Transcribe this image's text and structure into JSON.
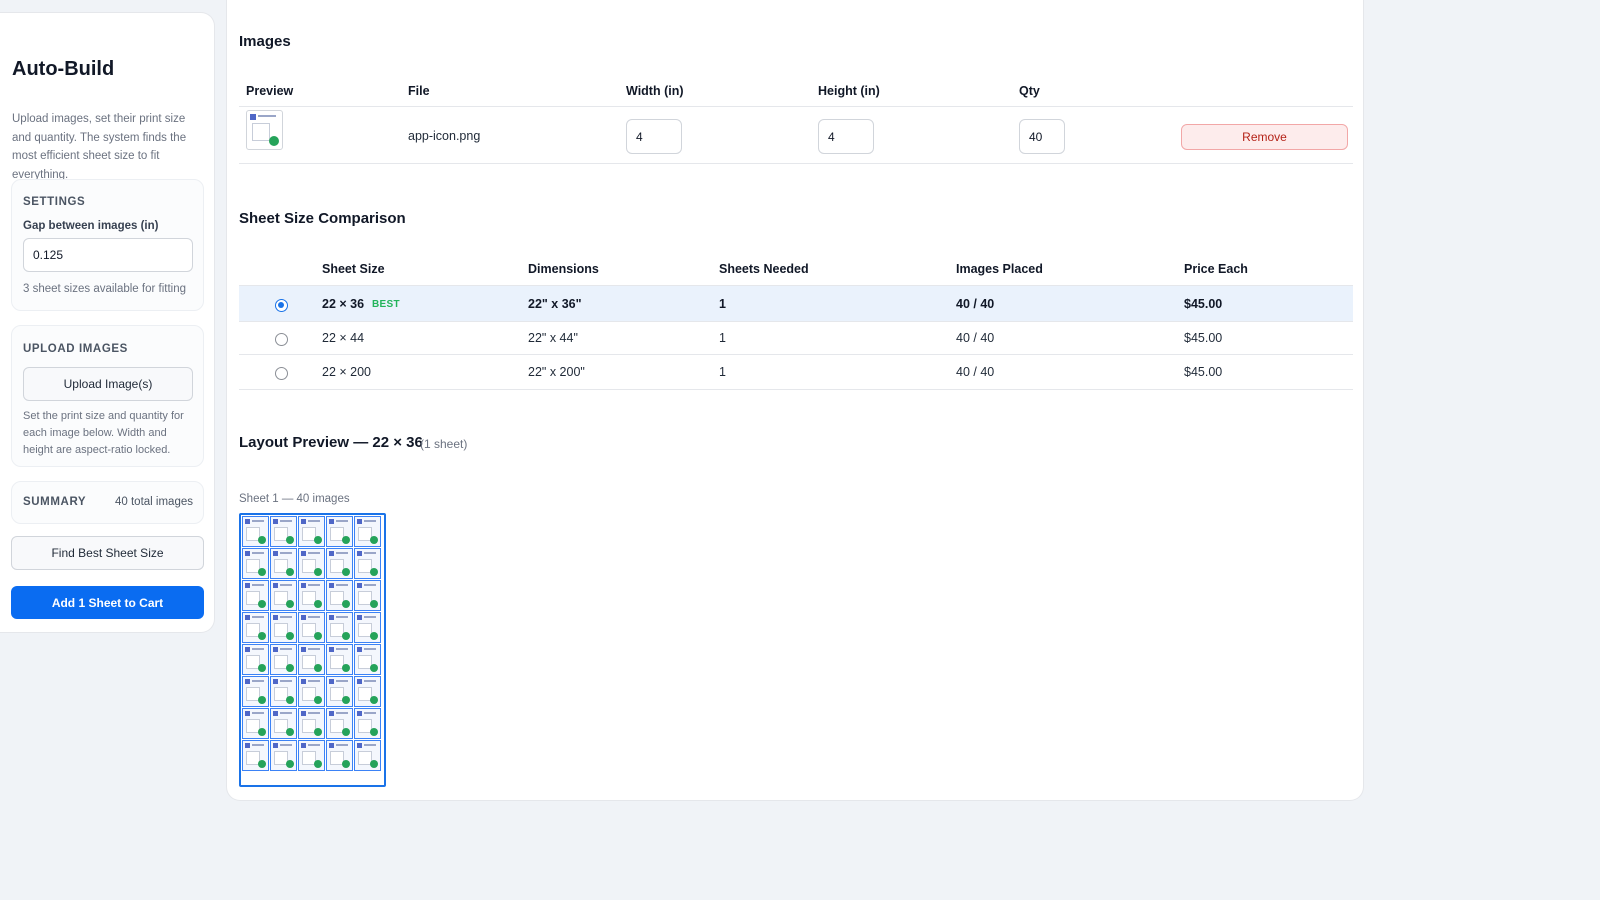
{
  "sidebar": {
    "title": "Auto-Build",
    "description": "Upload images, set their print size and quantity. The system finds the most efficient sheet size to fit everything.",
    "settings": {
      "heading": "SETTINGS",
      "gap_label": "Gap between images (in)",
      "gap_value": "0.125",
      "sizes_hint": "3 sheet sizes available for fitting"
    },
    "upload": {
      "heading": "UPLOAD IMAGES",
      "button_label": "Upload Image(s)",
      "hint": "Set the print size and quantity for each image below. Width and height are aspect-ratio locked."
    },
    "summary": {
      "heading": "SUMMARY",
      "value": "40 total images"
    },
    "find_button": "Find Best Sheet Size",
    "cart_button": "Add 1 Sheet to Cart"
  },
  "images": {
    "heading": "Images",
    "columns": [
      "Preview",
      "File",
      "Width (in)",
      "Height (in)",
      "Qty"
    ],
    "rows": [
      {
        "file": "app-icon.png",
        "width": "4",
        "height": "4",
        "qty": "40",
        "remove_label": "Remove",
        "icon": "image-thumbnail-icon"
      }
    ]
  },
  "comparison": {
    "heading": "Sheet Size Comparison",
    "columns": [
      "Sheet Size",
      "Dimensions",
      "Sheets Needed",
      "Images Placed",
      "Price Each"
    ],
    "rows": [
      {
        "size": "22 × 36",
        "badge": "BEST",
        "dimensions": "22\" x 36\"",
        "sheets": "1",
        "placed": "40 / 40",
        "price": "$45.00",
        "selected": true
      },
      {
        "size": "22 × 44",
        "badge": "",
        "dimensions": "22\" x 44\"",
        "sheets": "1",
        "placed": "40 / 40",
        "price": "$45.00",
        "selected": false
      },
      {
        "size": "22 × 200",
        "badge": "",
        "dimensions": "22\" x 200\"",
        "sheets": "1",
        "placed": "40 / 40",
        "price": "$45.00",
        "selected": false
      }
    ]
  },
  "layout_preview": {
    "heading": "Layout Preview — 22 × 36",
    "subheading": "(1 sheet)",
    "sheet_caption": "Sheet 1 — 40 images",
    "tile_count": 40
  },
  "colors": {
    "accent": "#0a6cf1",
    "best_badge": "#22b45a",
    "selected_row": "#eaf2fc",
    "remove": "#b42318"
  }
}
